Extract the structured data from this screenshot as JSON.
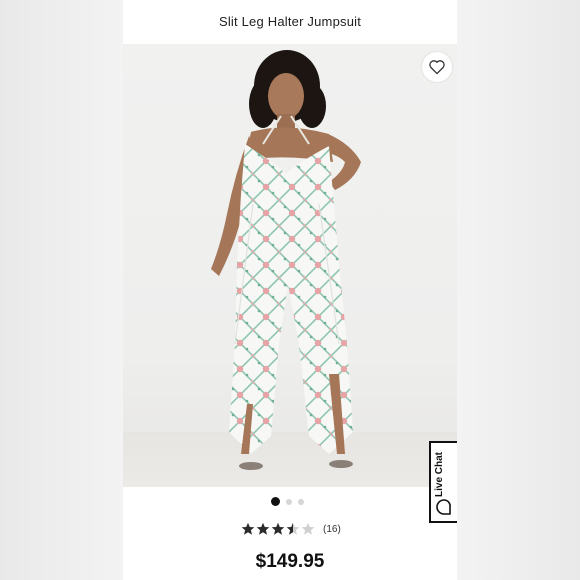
{
  "product": {
    "title": "Slit Leg Halter Jumpsuit",
    "price": "$149.95",
    "rating": {
      "stars": 3.5,
      "max": 5,
      "count_label": "(16)"
    }
  },
  "gallery": {
    "total_images": 3,
    "active_index": 0
  },
  "live_chat": {
    "label": "Live Chat"
  },
  "icons": {
    "favorite": "heart-outline-icon",
    "chat": "chat-bubble-icon",
    "star": "star-icon"
  },
  "colors": {
    "star_filled": "#2b2b2b",
    "star_empty": "#d0d0d0",
    "dot_active": "#111111",
    "dot_inactive": "#d6d6d6"
  }
}
